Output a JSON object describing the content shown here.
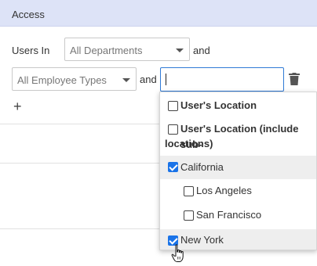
{
  "section": {
    "title": "Access"
  },
  "row1": {
    "label": "Users In",
    "department_select": "All Departments",
    "connector": "and"
  },
  "row2": {
    "employee_type_select": "All Employee Types",
    "connector": "and",
    "search_value": ""
  },
  "add_label": "+",
  "dropdown": {
    "options": [
      {
        "label": "User's Location",
        "checked": false,
        "bold": true
      },
      {
        "label": "User's Location (include sub-",
        "label_line2": "locations)",
        "checked": false,
        "bold": true
      },
      {
        "label": "California",
        "checked": true,
        "bold": false
      },
      {
        "label": "Los Angeles",
        "checked": false,
        "bold": false
      },
      {
        "label": "San Francisco",
        "checked": false,
        "bold": false
      },
      {
        "label": "New York",
        "checked": true,
        "bold": false
      }
    ]
  },
  "colors": {
    "header_bg": "#dde3f7",
    "accent": "#1a73e8",
    "focus_border": "#2f7ad6"
  },
  "icons": {
    "delete": "trash-icon",
    "add": "plus-icon",
    "cursor": "hand-pointer-icon"
  }
}
